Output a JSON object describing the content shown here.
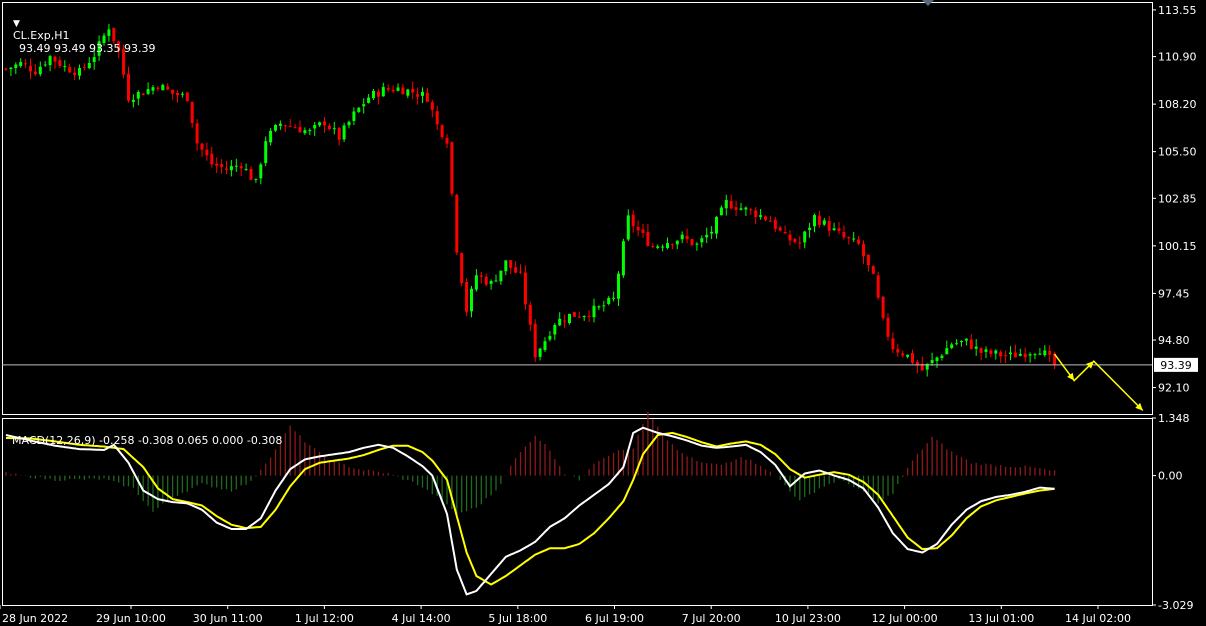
{
  "header": {
    "symbol_label": "CL.Exp,H1",
    "ohlc_label": "93.49 93.49 93.35 93.39"
  },
  "macd_header": {
    "label": "MACD(12,26,9) -0.258 -0.308 0.065 0.000 -0.308"
  },
  "colors": {
    "background": "#000000",
    "frame": "#ffffff",
    "bull": "#00ff00",
    "bear": "#ff0000",
    "price_line": "#c0c0c0",
    "signal": "#ffff00",
    "macd_line": "#ffffff",
    "hist_pos": "#8b1a1a",
    "hist_neg": "#1e6b1e",
    "arrow": "#ffff00"
  },
  "chart_data": [
    {
      "type": "candlestick",
      "symbol": "CL.Exp",
      "timeframe": "H1",
      "y_ticks": [
        "113.55",
        "110.90",
        "108.20",
        "105.50",
        "102.85",
        "100.15",
        "97.45",
        "94.80",
        "92.10"
      ],
      "ylim": [
        90.6,
        114.0
      ],
      "current_price": 93.39,
      "current_price_label": "93.39",
      "x_labels": [
        "28 Jun 2022",
        "29 Jun 10:00",
        "30 Jun 11:00",
        "1 Jul 12:00",
        "4 Jul 14:00",
        "5 Jul 18:00",
        "6 Jul 19:00",
        "7 Jul 20:00",
        "10 Jul 23:00",
        "12 Jul 00:00",
        "13 Jul 01:00",
        "14 Jul 02:00"
      ],
      "close_path": [
        [
          0,
          110.2
        ],
        [
          3,
          110.5
        ],
        [
          6,
          110.1
        ],
        [
          9,
          110.9
        ],
        [
          12,
          110.3
        ],
        [
          15,
          110.0
        ],
        [
          18,
          111.0
        ],
        [
          21,
          112.6
        ],
        [
          23,
          111.2
        ],
        [
          25,
          108.6
        ],
        [
          28,
          108.9
        ],
        [
          31,
          109.3
        ],
        [
          34,
          108.8
        ],
        [
          37,
          108.6
        ],
        [
          39,
          106.0
        ],
        [
          42,
          104.8
        ],
        [
          45,
          104.5
        ],
        [
          48,
          104.8
        ],
        [
          51,
          103.7
        ],
        [
          53,
          106.2
        ],
        [
          56,
          107.1
        ],
        [
          59,
          106.9
        ],
        [
          62,
          106.6
        ],
        [
          65,
          107.2
        ],
        [
          68,
          106.3
        ],
        [
          71,
          107.6
        ],
        [
          74,
          108.6
        ],
        [
          77,
          109.0
        ],
        [
          80,
          109.1
        ],
        [
          83,
          108.9
        ],
        [
          86,
          108.6
        ],
        [
          88,
          107.0
        ],
        [
          90,
          106.2
        ],
        [
          92,
          100.0
        ],
        [
          94,
          96.5
        ],
        [
          96,
          98.5
        ],
        [
          99,
          98.0
        ],
        [
          102,
          99.2
        ],
        [
          105,
          98.4
        ],
        [
          108,
          94.0
        ],
        [
          110,
          94.8
        ],
        [
          112,
          95.8
        ],
        [
          115,
          96.2
        ],
        [
          118,
          96.3
        ],
        [
          121,
          96.6
        ],
        [
          124,
          97.1
        ],
        [
          127,
          101.7
        ],
        [
          129,
          101.0
        ],
        [
          132,
          100.1
        ],
        [
          135,
          100.4
        ],
        [
          138,
          100.6
        ],
        [
          141,
          100.2
        ],
        [
          144,
          101.0
        ],
        [
          147,
          102.6
        ],
        [
          150,
          102.3
        ],
        [
          153,
          102.0
        ],
        [
          156,
          101.6
        ],
        [
          159,
          100.6
        ],
        [
          162,
          100.3
        ],
        [
          165,
          101.8
        ],
        [
          168,
          101.2
        ],
        [
          171,
          100.6
        ],
        [
          174,
          100.2
        ],
        [
          177,
          98.3
        ],
        [
          179,
          95.8
        ],
        [
          181,
          94.4
        ],
        [
          184,
          93.9
        ],
        [
          187,
          93.1
        ],
        [
          190,
          93.8
        ],
        [
          193,
          94.6
        ],
        [
          196,
          94.7
        ],
        [
          199,
          94.1
        ],
        [
          202,
          94.0
        ],
        [
          205,
          93.9
        ],
        [
          208,
          94.1
        ],
        [
          211,
          94.3
        ],
        [
          214,
          93.4
        ]
      ],
      "arrow": [
        [
          214,
          94.0
        ],
        [
          218,
          92.5
        ],
        [
          222,
          93.6
        ],
        [
          232,
          90.8
        ]
      ]
    },
    {
      "type": "line",
      "name": "MACD(12,26,9)",
      "y_ticks": [
        "1.348",
        "0.00",
        "-3.029"
      ],
      "ylim": [
        -3.029,
        1.348
      ],
      "values_label": "-0.258 -0.308 0.065 0.000 -0.308",
      "series": [
        {
          "role": "macd_line",
          "values": [
            [
              0,
              0.95
            ],
            [
              5,
              0.82
            ],
            [
              10,
              0.7
            ],
            [
              15,
              0.62
            ],
            [
              20,
              0.6
            ],
            [
              22,
              0.72
            ],
            [
              25,
              0.3
            ],
            [
              28,
              -0.35
            ],
            [
              31,
              -0.55
            ],
            [
              34,
              -0.62
            ],
            [
              37,
              -0.65
            ],
            [
              40,
              -0.8
            ],
            [
              43,
              -1.1
            ],
            [
              46,
              -1.25
            ],
            [
              49,
              -1.25
            ],
            [
              52,
              -1.0
            ],
            [
              55,
              -0.35
            ],
            [
              58,
              0.15
            ],
            [
              61,
              0.38
            ],
            [
              64,
              0.45
            ],
            [
              67,
              0.5
            ],
            [
              70,
              0.55
            ],
            [
              73,
              0.65
            ],
            [
              76,
              0.72
            ],
            [
              79,
              0.65
            ],
            [
              82,
              0.45
            ],
            [
              85,
              0.22
            ],
            [
              87,
              0.0
            ],
            [
              90,
              -0.9
            ],
            [
              92,
              -2.2
            ],
            [
              94,
              -2.78
            ],
            [
              96,
              -2.7
            ],
            [
              99,
              -2.3
            ],
            [
              102,
              -1.9
            ],
            [
              105,
              -1.75
            ],
            [
              108,
              -1.55
            ],
            [
              111,
              -1.2
            ],
            [
              114,
              -1.0
            ],
            [
              117,
              -0.7
            ],
            [
              120,
              -0.45
            ],
            [
              123,
              -0.2
            ],
            [
              126,
              0.2
            ],
            [
              128,
              1.0
            ],
            [
              130,
              1.12
            ],
            [
              133,
              1.0
            ],
            [
              136,
              0.92
            ],
            [
              139,
              0.82
            ],
            [
              142,
              0.7
            ],
            [
              145,
              0.65
            ],
            [
              148,
              0.68
            ],
            [
              151,
              0.72
            ],
            [
              154,
              0.55
            ],
            [
              157,
              0.25
            ],
            [
              160,
              -0.25
            ],
            [
              163,
              0.05
            ],
            [
              166,
              0.12
            ],
            [
              169,
              0.0
            ],
            [
              172,
              -0.1
            ],
            [
              175,
              -0.3
            ],
            [
              178,
              -0.75
            ],
            [
              181,
              -1.35
            ],
            [
              184,
              -1.72
            ],
            [
              187,
              -1.8
            ],
            [
              190,
              -1.6
            ],
            [
              193,
              -1.15
            ],
            [
              196,
              -0.8
            ],
            [
              199,
              -0.6
            ],
            [
              202,
              -0.5
            ],
            [
              205,
              -0.45
            ],
            [
              208,
              -0.38
            ],
            [
              211,
              -0.28
            ],
            [
              214,
              -0.31
            ]
          ]
        },
        {
          "role": "signal_line",
          "values": [
            [
              0,
              0.88
            ],
            [
              5,
              0.87
            ],
            [
              10,
              0.8
            ],
            [
              15,
              0.72
            ],
            [
              20,
              0.68
            ],
            [
              24,
              0.62
            ],
            [
              28,
              0.2
            ],
            [
              31,
              -0.3
            ],
            [
              34,
              -0.55
            ],
            [
              37,
              -0.62
            ],
            [
              40,
              -0.7
            ],
            [
              43,
              -0.95
            ],
            [
              46,
              -1.15
            ],
            [
              49,
              -1.23
            ],
            [
              52,
              -1.2
            ],
            [
              55,
              -0.8
            ],
            [
              58,
              -0.25
            ],
            [
              61,
              0.15
            ],
            [
              64,
              0.3
            ],
            [
              67,
              0.35
            ],
            [
              70,
              0.4
            ],
            [
              73,
              0.48
            ],
            [
              76,
              0.6
            ],
            [
              79,
              0.7
            ],
            [
              82,
              0.7
            ],
            [
              85,
              0.55
            ],
            [
              87,
              0.35
            ],
            [
              90,
              -0.1
            ],
            [
              92,
              -0.95
            ],
            [
              94,
              -1.8
            ],
            [
              96,
              -2.35
            ],
            [
              99,
              -2.55
            ],
            [
              102,
              -2.35
            ],
            [
              105,
              -2.1
            ],
            [
              108,
              -1.85
            ],
            [
              111,
              -1.7
            ],
            [
              114,
              -1.7
            ],
            [
              117,
              -1.6
            ],
            [
              120,
              -1.35
            ],
            [
              123,
              -1.0
            ],
            [
              126,
              -0.6
            ],
            [
              128,
              -0.1
            ],
            [
              130,
              0.5
            ],
            [
              133,
              0.95
            ],
            [
              136,
              1.0
            ],
            [
              139,
              0.9
            ],
            [
              142,
              0.78
            ],
            [
              145,
              0.68
            ],
            [
              148,
              0.75
            ],
            [
              151,
              0.8
            ],
            [
              154,
              0.72
            ],
            [
              157,
              0.5
            ],
            [
              160,
              0.15
            ],
            [
              163,
              -0.05
            ],
            [
              166,
              0.02
            ],
            [
              169,
              0.08
            ],
            [
              172,
              0.02
            ],
            [
              175,
              -0.15
            ],
            [
              178,
              -0.45
            ],
            [
              181,
              -0.95
            ],
            [
              184,
              -1.45
            ],
            [
              187,
              -1.72
            ],
            [
              190,
              -1.7
            ],
            [
              193,
              -1.4
            ],
            [
              196,
              -1.0
            ],
            [
              199,
              -0.72
            ],
            [
              202,
              -0.58
            ],
            [
              205,
              -0.5
            ],
            [
              208,
              -0.42
            ],
            [
              211,
              -0.35
            ],
            [
              214,
              -0.31
            ]
          ]
        }
      ],
      "histogram_envelope": [
        [
          0,
          0.05
        ],
        [
          10,
          -0.1
        ],
        [
          20,
          -0.08
        ],
        [
          26,
          -0.3
        ],
        [
          30,
          -0.85
        ],
        [
          34,
          -0.5
        ],
        [
          40,
          -0.2
        ],
        [
          46,
          -0.35
        ],
        [
          50,
          -0.15
        ],
        [
          55,
          0.6
        ],
        [
          58,
          1.15
        ],
        [
          61,
          0.8
        ],
        [
          66,
          0.35
        ],
        [
          72,
          0.15
        ],
        [
          78,
          0.05
        ],
        [
          84,
          -0.2
        ],
        [
          88,
          -0.5
        ],
        [
          92,
          -0.9
        ],
        [
          96,
          -0.75
        ],
        [
          100,
          -0.35
        ],
        [
          104,
          0.4
        ],
        [
          108,
          0.95
        ],
        [
          111,
          0.6
        ],
        [
          114,
          0.05
        ],
        [
          117,
          -0.1
        ],
        [
          120,
          0.3
        ],
        [
          124,
          0.55
        ],
        [
          128,
          0.65
        ],
        [
          131,
          1.48
        ],
        [
          134,
          0.95
        ],
        [
          138,
          0.5
        ],
        [
          142,
          0.3
        ],
        [
          146,
          0.25
        ],
        [
          150,
          0.45
        ],
        [
          154,
          0.25
        ],
        [
          158,
          -0.1
        ],
        [
          162,
          -0.6
        ],
        [
          166,
          -0.3
        ],
        [
          170,
          -0.1
        ],
        [
          174,
          -0.3
        ],
        [
          178,
          -0.65
        ],
        [
          181,
          -0.4
        ],
        [
          185,
          0.35
        ],
        [
          189,
          0.9
        ],
        [
          193,
          0.55
        ],
        [
          197,
          0.3
        ],
        [
          201,
          0.25
        ],
        [
          205,
          0.22
        ],
        [
          209,
          0.2
        ],
        [
          214,
          0.1
        ]
      ]
    }
  ]
}
